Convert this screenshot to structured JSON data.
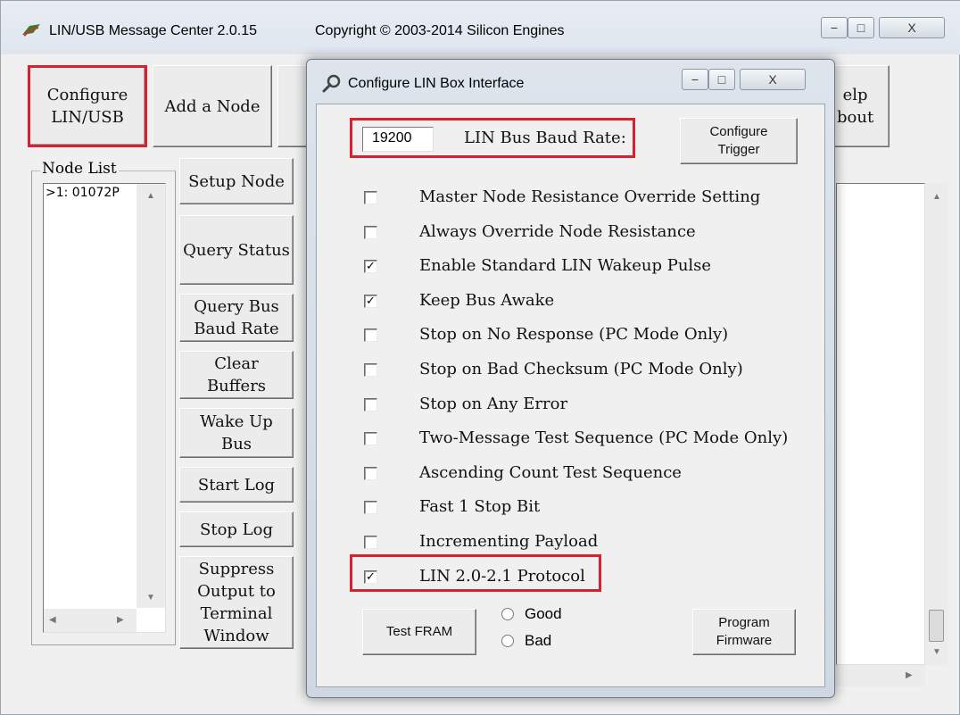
{
  "main_window": {
    "title": "LIN/USB Message Center 2.0.15",
    "copyright": "Copyright © 2003-2014 Silicon Engines",
    "caption_buttons": {
      "minimize": "−",
      "maximize": "□",
      "close": "X"
    }
  },
  "toolbar": {
    "configure_label": "Configure\nLIN/USB",
    "add_node_label": "Add a Node",
    "help_label_partial": "elp\nbout"
  },
  "node_list": {
    "label": "Node List",
    "items": [
      ">1: 01072P"
    ]
  },
  "side_buttons": {
    "setup_node": "Setup Node",
    "query_status": "Query Status",
    "query_baud": "Query Bus\nBaud Rate",
    "clear_buffers": "Clear\nBuffers",
    "wake_up_bus": "Wake Up\nBus",
    "start_log": "Start Log",
    "stop_log": "Stop Log",
    "suppress_output": "Suppress\nOutput to\nTerminal\nWindow"
  },
  "dialog": {
    "title": "Configure LIN Box Interface",
    "baud_value": "19200",
    "baud_label": "LIN Bus Baud Rate:",
    "configure_trigger": "Configure\nTrigger",
    "options": [
      {
        "label": "Master Node Resistance Override Setting",
        "checked": false
      },
      {
        "label": "Always Override Node Resistance",
        "checked": false
      },
      {
        "label": "Enable Standard LIN Wakeup Pulse",
        "checked": true
      },
      {
        "label": "Keep Bus Awake",
        "checked": true
      },
      {
        "label": "Stop on No Response (PC Mode Only)",
        "checked": false
      },
      {
        "label": "Stop on Bad Checksum (PC Mode Only)",
        "checked": false
      },
      {
        "label": "Stop on Any Error",
        "checked": false
      },
      {
        "label": "Two-Message Test Sequence (PC Mode Only)",
        "checked": false
      },
      {
        "label": "Ascending Count Test Sequence",
        "checked": false
      },
      {
        "label": "Fast 1 Stop Bit",
        "checked": false
      },
      {
        "label": "Incrementing Payload",
        "checked": false
      },
      {
        "label": "LIN 2.0-2.1 Protocol",
        "checked": true
      }
    ],
    "test_fram": "Test FRAM",
    "radio_good": "Good",
    "radio_bad": "Bad",
    "program_firmware": "Program\nFirmware",
    "check_glyph": "✓",
    "caption_buttons": {
      "minimize": "−",
      "maximize": "□",
      "close": "X"
    }
  },
  "colors": {
    "highlight": "#d8212f",
    "window_bg": "#f0f0f0"
  }
}
